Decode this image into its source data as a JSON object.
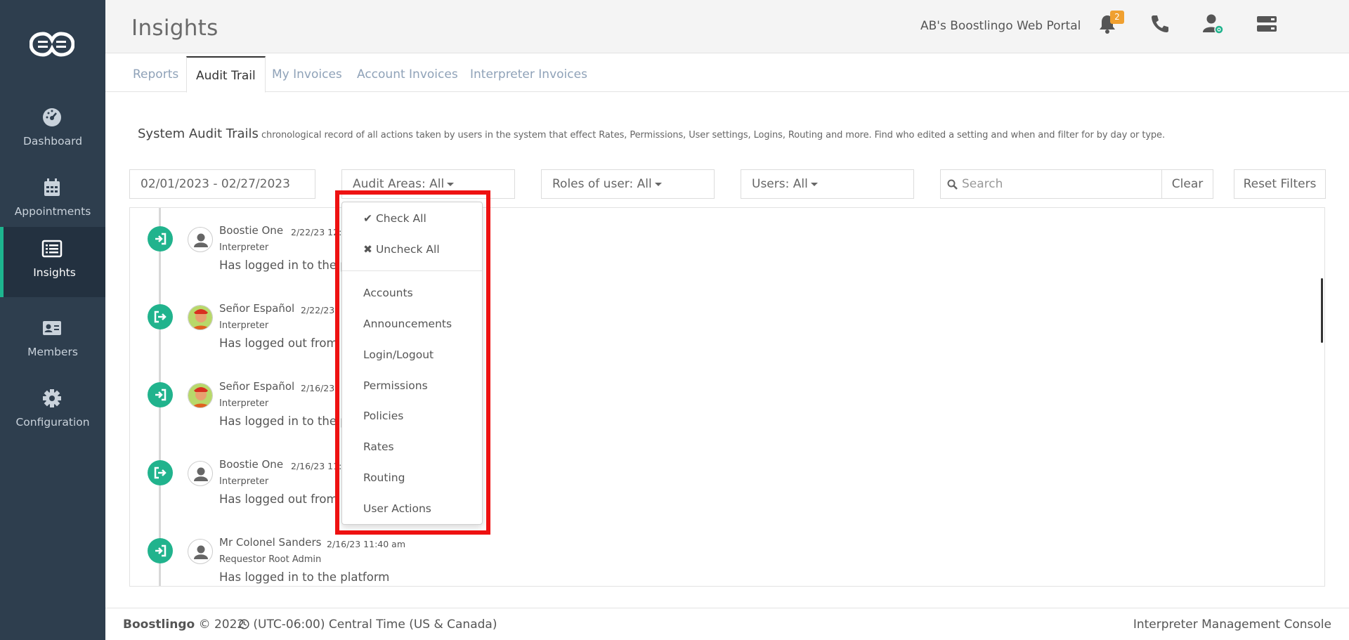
{
  "sidebar": {
    "logo": "boostlingo-logo",
    "items": [
      {
        "label": "Dashboard",
        "icon": "dashboard-icon"
      },
      {
        "label": "Appointments",
        "icon": "calendar-icon"
      },
      {
        "label": "Insights",
        "icon": "list-icon",
        "active": true
      },
      {
        "label": "Members",
        "icon": "id-card-icon"
      },
      {
        "label": "Configuration",
        "icon": "gear-icon"
      }
    ]
  },
  "header": {
    "title": "Insights",
    "portal_name": "AB's Boostlingo Web Portal",
    "notification_count": "2"
  },
  "tabs": [
    "Reports",
    "Audit Trail",
    "My Invoices",
    "Account Invoices",
    "Interpreter Invoices"
  ],
  "active_tab": "Audit Trail",
  "section": {
    "title": "System Audit Trails",
    "description": "chronological record of all actions taken by users in the system that effect Rates, Permissions, User settings, Logins, Routing and more. Find who edited a setting and when and filter for by day or type."
  },
  "filters": {
    "date_range": "02/01/2023 - 02/27/2023",
    "audit_areas": "Audit Areas: All",
    "roles": "Roles of user: All",
    "users": "Users: All",
    "search_placeholder": "Search",
    "clear_label": "Clear",
    "reset_label": "Reset Filters"
  },
  "dropdown": {
    "check_all": "Check All",
    "uncheck_all": "Uncheck All",
    "options": [
      "Accounts",
      "Announcements",
      "Login/Logout",
      "Permissions",
      "Policies",
      "Rates",
      "Routing",
      "User Actions"
    ]
  },
  "entries": [
    {
      "name": "Boostie One",
      "date": "2/22/23 12:1",
      "role": "Interpreter",
      "message": "Has logged in to the pla",
      "type": "login",
      "avatar": "default"
    },
    {
      "name": "Señor Español",
      "date": "2/22/23",
      "role": "Interpreter",
      "message": "Has logged out from th",
      "type": "logout",
      "avatar": "photo"
    },
    {
      "name": "Señor Español",
      "date": "2/16/23",
      "role": "Interpreter",
      "message": "Has logged in to the pla",
      "type": "login",
      "avatar": "photo"
    },
    {
      "name": "Boostie One",
      "date": "2/16/23 11:4",
      "role": "Interpreter",
      "message": "Has logged out from th",
      "type": "logout",
      "avatar": "default"
    },
    {
      "name": "Mr Colonel Sanders",
      "date": "2/16/23 11:40 am",
      "role": "Requestor Root Admin",
      "message": "Has logged in to the platform",
      "type": "login",
      "avatar": "default"
    }
  ],
  "footer": {
    "brand": "Boostlingo",
    "copyright": "© 2022",
    "timezone": "(UTC-06:00) Central Time (US & Canada)",
    "console": "Interpreter Management Console"
  },
  "colors": {
    "sidebar_bg": "#2e3e4e",
    "accent": "#1db58f",
    "badge": "#f0a030",
    "highlight": "#ee1111"
  }
}
